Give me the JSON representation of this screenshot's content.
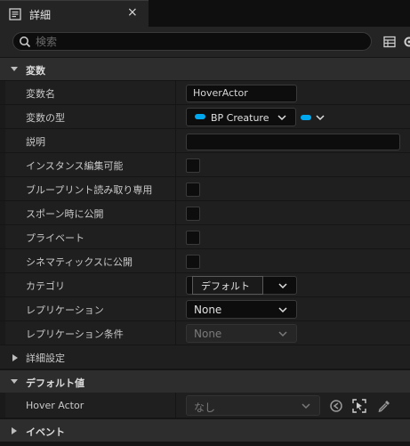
{
  "tab": {
    "title": "詳細",
    "close": "×"
  },
  "search": {
    "placeholder": "検索"
  },
  "sections": {
    "variables": "変数",
    "advanced": "詳細設定",
    "default_value": "デフォルト値",
    "events": "イベント"
  },
  "rows": {
    "var_name": {
      "label": "変数名",
      "value": "HoverActor"
    },
    "var_type": {
      "label": "変数の型",
      "value": "BP Creature"
    },
    "description": {
      "label": "説明",
      "value": ""
    },
    "instance_editable": {
      "label": "インスタンス編集可能"
    },
    "blueprint_readonly": {
      "label": "ブループリント読み取り専用"
    },
    "expose_on_spawn": {
      "label": "スポーン時に公開"
    },
    "private": {
      "label": "プライベート"
    },
    "expose_to_cinematics": {
      "label": "シネマティックスに公開"
    },
    "category": {
      "label": "カテゴリ",
      "value": "デフォルト"
    },
    "replication": {
      "label": "レプリケーション",
      "value": "None"
    },
    "replication_condition": {
      "label": "レプリケーション条件",
      "value": "None"
    },
    "hover_actor": {
      "label": "Hover Actor",
      "value": "なし"
    }
  },
  "colors": {
    "accent": "#00a8f0",
    "panel": "#1f1f1f",
    "section": "#2d2d2d"
  }
}
